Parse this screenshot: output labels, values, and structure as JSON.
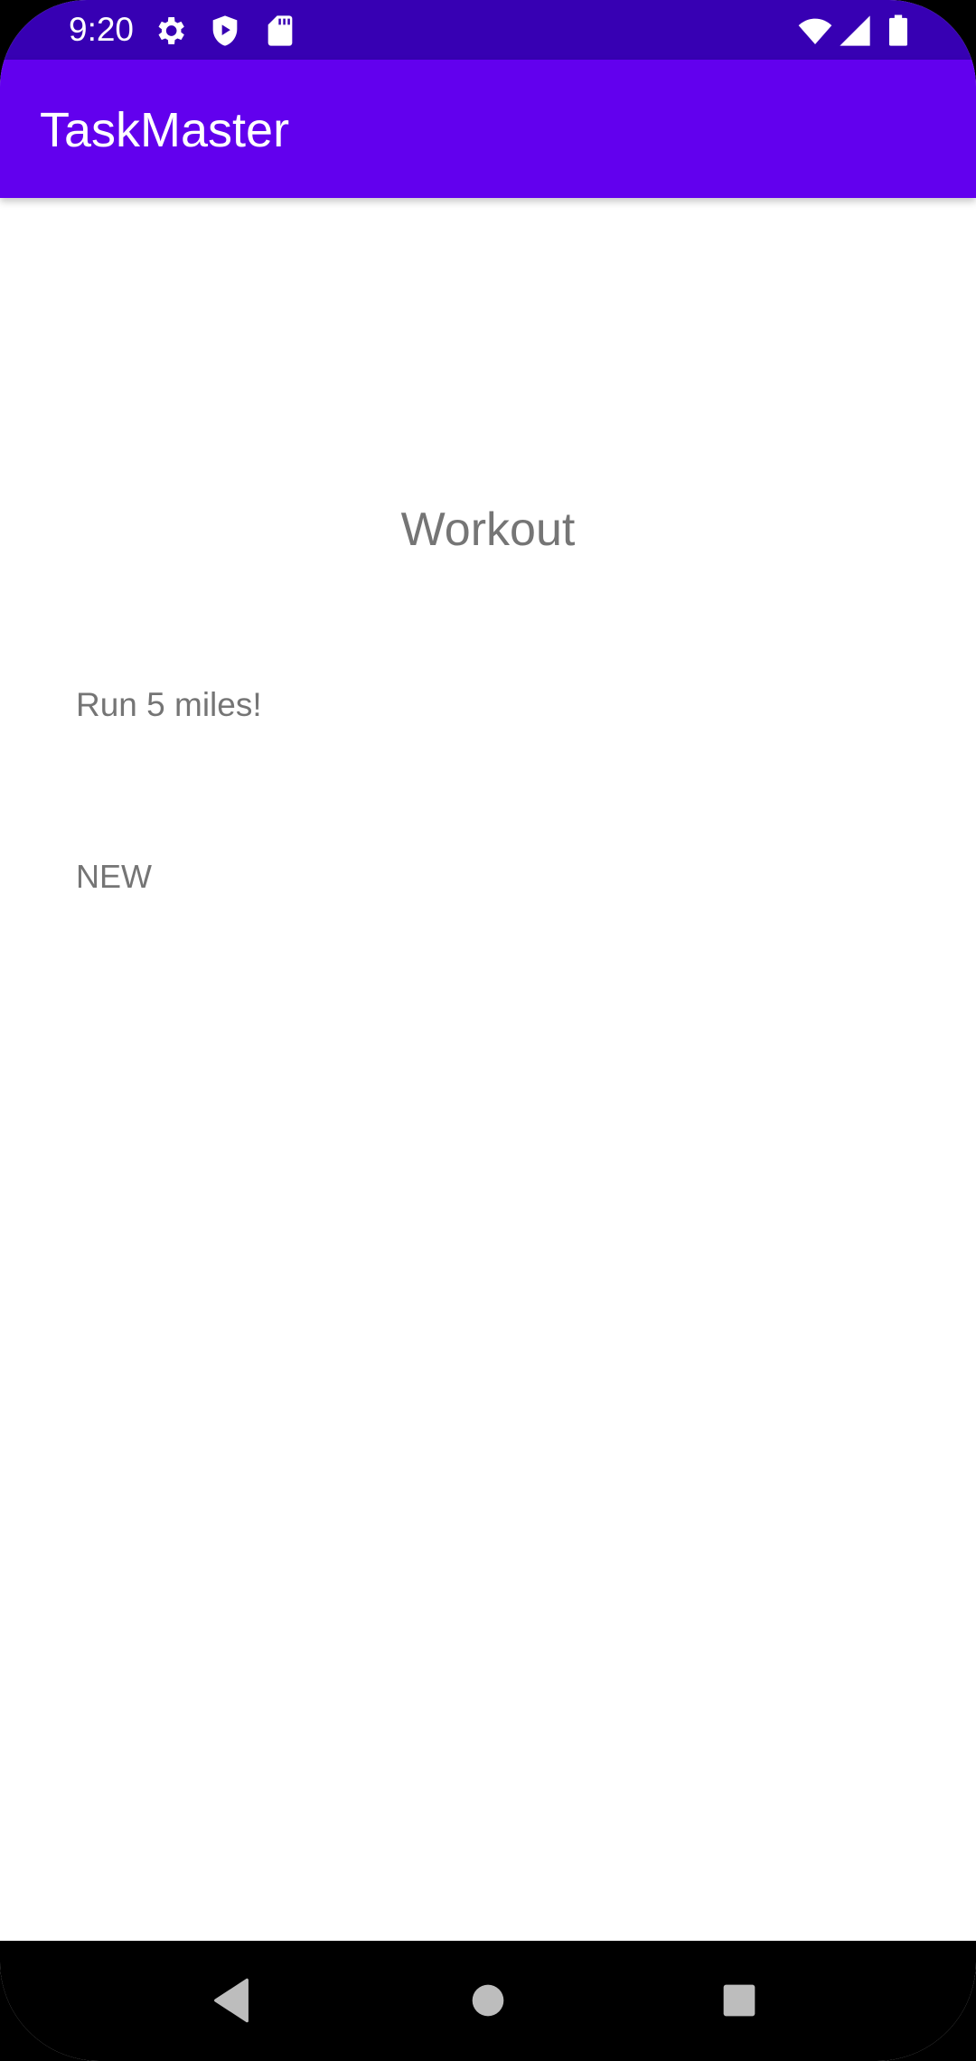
{
  "status_bar": {
    "time": "9:20",
    "left_icons": [
      "gear-icon",
      "shield-play-icon",
      "sd-card-icon"
    ],
    "right_icons": [
      "wifi-icon",
      "signal-icon",
      "battery-icon"
    ],
    "background": "#3700B3"
  },
  "app_bar": {
    "title": "TaskMaster",
    "background": "#6200EE"
  },
  "task": {
    "title": "Workout",
    "body": "Run 5 miles!",
    "state": "NEW"
  },
  "nav_bar": {
    "buttons": [
      "back-icon",
      "home-icon",
      "recents-icon"
    ]
  }
}
